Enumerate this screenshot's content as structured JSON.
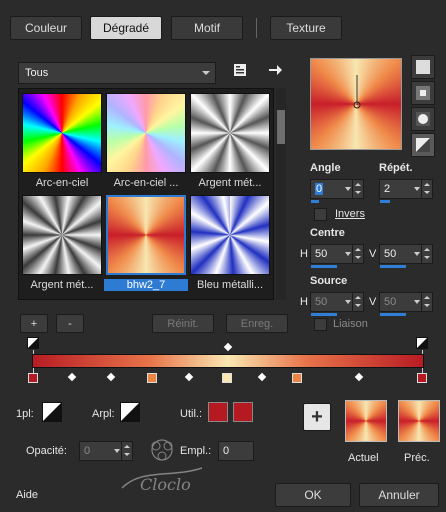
{
  "tabs": [
    {
      "label": "Couleur"
    },
    {
      "label": "Dégradé"
    },
    {
      "label": "Motif"
    },
    {
      "label": "Texture"
    }
  ],
  "library": {
    "category_value": "Tous",
    "thumbnails": [
      {
        "label": "Arc-en-ciel"
      },
      {
        "label": "Arc-en-ciel ..."
      },
      {
        "label": "Argent mét..."
      },
      {
        "label": "Argent mét..."
      },
      {
        "label": "bhw2_7"
      },
      {
        "label": "Bleu métalli..."
      }
    ]
  },
  "buttons": {
    "add": "+",
    "remove": "-",
    "reset": "Réinit.",
    "save": "Enreg."
  },
  "angle": {
    "label": "Angle",
    "value": "0"
  },
  "repeat": {
    "label": "Répét.",
    "value": "2"
  },
  "invert": {
    "label": "Invers"
  },
  "centre": {
    "label": "Centre",
    "h_label": "H",
    "h_value": "50",
    "v_label": "V",
    "v_value": "50"
  },
  "source": {
    "label": "Source",
    "h_label": "H",
    "h_value": "50",
    "v_label": "V",
    "v_value": "50"
  },
  "link": {
    "label": "Liaison"
  },
  "bottom": {
    "opl_label": "1pl:",
    "arpl_label": "Arpl:",
    "util_label": "Util.:",
    "opacity_label": "Opacité:",
    "opacity_value": "0",
    "empl_label": "Empl.:",
    "empl_value": "0",
    "plus": "+",
    "current_label": "Actuel",
    "previous_label": "Préc."
  },
  "footer": {
    "help": "Aide",
    "ok": "OK",
    "cancel": "Annuler"
  },
  "colors": {
    "accent": "#2e7bd4",
    "util_red": "#b51a22"
  }
}
